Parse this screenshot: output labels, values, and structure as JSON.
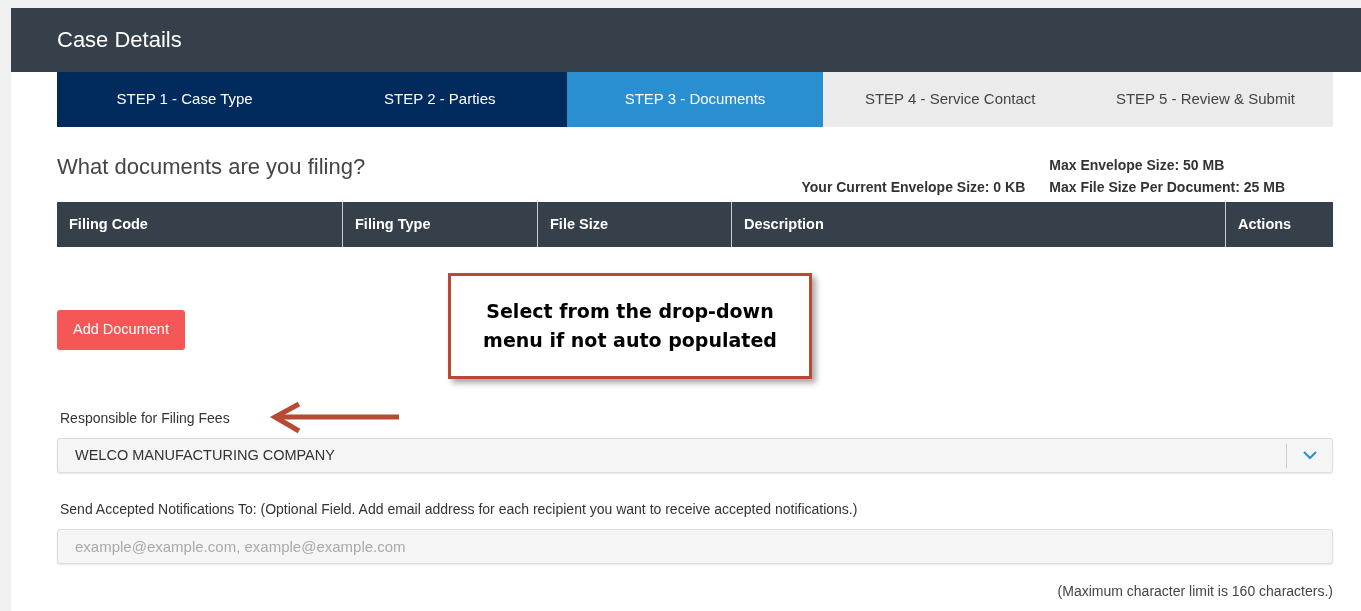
{
  "header": {
    "title": "Case Details"
  },
  "steps": [
    {
      "label": "STEP 1 - Case Type",
      "selected": false,
      "completed": true
    },
    {
      "label": "STEP 2 - Parties",
      "selected": false,
      "completed": true
    },
    {
      "label": "STEP 3 - Documents",
      "selected": true,
      "completed": false
    },
    {
      "label": "STEP 4 - Service Contact",
      "selected": false,
      "completed": false
    },
    {
      "label": "STEP 5 - Review & Submit",
      "selected": false,
      "completed": false
    }
  ],
  "section_title": "What documents are you filing?",
  "envelope_info": {
    "current_size": "Your Current Envelope Size: 0 KB",
    "max_envelope": "Max Envelope Size: 50 MB",
    "max_file": "Max File Size Per Document: 25 MB"
  },
  "table": {
    "columns": [
      "Filing Code",
      "Filing Type",
      "File Size",
      "Description",
      "Actions"
    ]
  },
  "add_button": "Add Document",
  "callout": {
    "text": "Select from the drop-down menu if not auto populated"
  },
  "fees": {
    "label": "Responsible for Filing Fees",
    "value": "WELCO MANUFACTURING COMPANY"
  },
  "notifications": {
    "label": "Send Accepted Notifications To: (Optional Field. Add email address for each recipient you want to receive accepted notifications.)",
    "placeholder": "example@example.com, example@example.com",
    "hint": "(Maximum character limit is 160 characters.)"
  }
}
